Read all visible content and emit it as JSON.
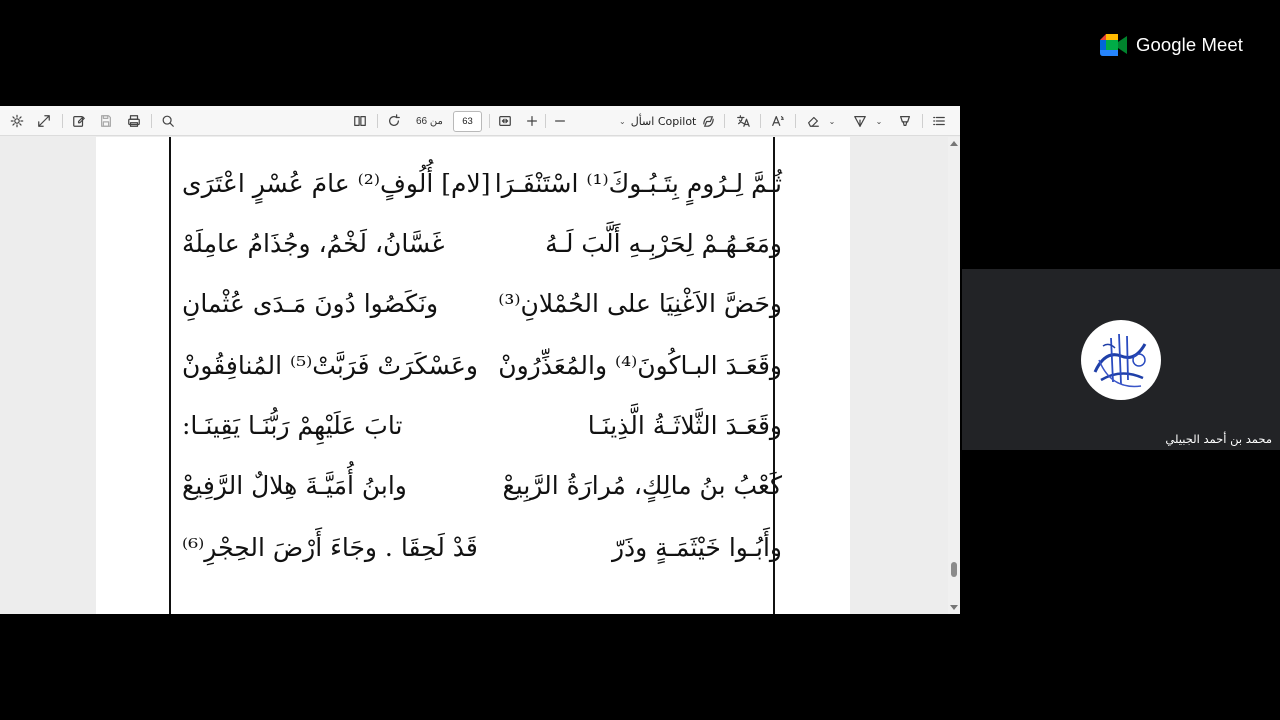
{
  "meet": {
    "brand": "Google Meet",
    "participant": "محمد بن أحمد الجبيلي",
    "colors": {
      "green": "#00832D",
      "blue": "#0066DA",
      "red": "#E94235",
      "yellow": "#FFBA00"
    }
  },
  "toolbar": {
    "copilot_label": "اسأل Copilot",
    "current_page": "63",
    "page_total": "من 66",
    "icons": [
      "settings-icon",
      "expand-icon",
      "edit-icon",
      "save-icon",
      "print-icon",
      "search-icon",
      "page-view-icon",
      "rotate-icon",
      "fit-width-icon",
      "zoom-in-icon",
      "zoom-out-icon",
      "copilot-icon",
      "translate-icon",
      "read-aloud-icon",
      "erase-icon",
      "draw-icon",
      "highlight-icon",
      "contents-icon"
    ]
  },
  "document": {
    "verses": [
      {
        "sadr": "ثُـمَّ لِـرُومٍ بِتَـبُـوكَ⁽¹⁾ اسْتَنْفَـرَا",
        "ajuz": "[لام] أُلُوفٍ⁽²⁾ عامَ عُسْرٍ اعْتَرَى"
      },
      {
        "sadr": "ومَعَـهُـمْ لِحَرْبِـهِ أَلَّبَ لَـهُ",
        "ajuz": "غَسَّانُ، لَخْمُ، وجُذَامُ عامِلَهْ"
      },
      {
        "sadr": "وحَضَّ الاَغْنِيَا على الحُمْلانِ⁽³⁾",
        "ajuz": "ونَكَصُوا دُونَ مَـدَى عُثْمانِ"
      },
      {
        "sadr": "وقَعَـدَ البـاكُونَ⁽⁴⁾ والمُعَذِّرُونْ",
        "ajuz": "وعَسْكَرَتْ فَرَبَّتْ⁽⁵⁾ المُنافِقُونْ"
      },
      {
        "sadr": "وقَعَـدَ الثَّلاثَـةُ الَّذِينَـا",
        "ajuz": "تابَ عَلَيْهِمْ رَبُّنَـا يَقِينَـا:"
      },
      {
        "sadr": "كَعْبُ بنُ مالِكٍ، مُرارَةُ الرَّبِيعْ",
        "ajuz": "وابنُ أُمَيَّـةَ هِلالٌ الرَّفِيعْ"
      },
      {
        "sadr": "وأَبُـوا خَيْثَمَـةٍ وذَرّ",
        "ajuz": "قَدْ لَحِقَا . وجَاءَ أَرْضَ الحِجْرِ⁽⁶⁾"
      }
    ]
  }
}
